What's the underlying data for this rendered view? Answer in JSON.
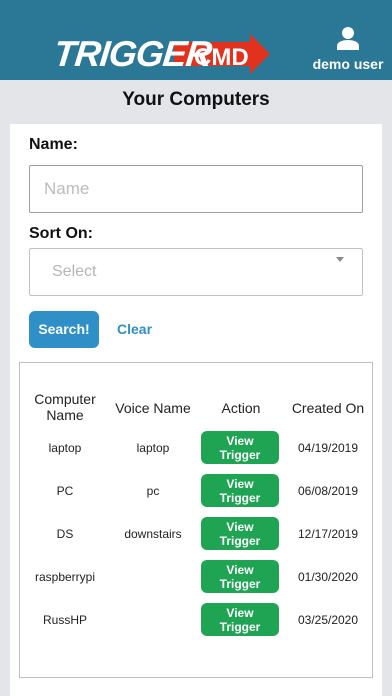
{
  "header": {
    "logo_word": "TRIGGER",
    "logo_suffix": "CMD",
    "user_label": "demo user",
    "colors": {
      "background": "#2a7896",
      "arrow": "#e2311d",
      "text": "#ffffff"
    }
  },
  "page": {
    "title": "Your Computers"
  },
  "form": {
    "name_label": "Name:",
    "name_placeholder": "Name",
    "sort_label": "Sort On:",
    "sort_value": "Select",
    "search_label": "Search!",
    "clear_label": "Clear"
  },
  "table": {
    "headers": {
      "computer_line1": "Computer",
      "computer_line2": "Name",
      "voice": "Voice Name",
      "action": "Action",
      "created": "Created On"
    },
    "rows": [
      {
        "computer": "laptop",
        "voice": "laptop",
        "action_line1": "View",
        "action_line2": "Trigger",
        "created": "04/19/2019"
      },
      {
        "computer": "PC",
        "voice": "pc",
        "action_line1": "View",
        "action_line2": "Trigger",
        "created": "06/08/2019"
      },
      {
        "computer": "DS",
        "voice": "downstairs",
        "action_line1": "View",
        "action_line2": "Trigger",
        "created": "12/17/2019"
      },
      {
        "computer": "raspberrypi",
        "voice": "",
        "action_line1": "View",
        "action_line2": "Trigger",
        "created": "01/30/2020"
      },
      {
        "computer": "RussHP",
        "voice": "",
        "action_line1": "View",
        "action_line2": "Trigger",
        "created": "03/25/2020"
      }
    ]
  },
  "icons": {
    "user": "user-icon",
    "dropdown": "chevron-down-icon",
    "logo_arrow": "arrow-right-icon"
  },
  "colors": {
    "primary": "#2f8fc7",
    "action": "#1ea453",
    "page_background": "#e4e5e9"
  }
}
